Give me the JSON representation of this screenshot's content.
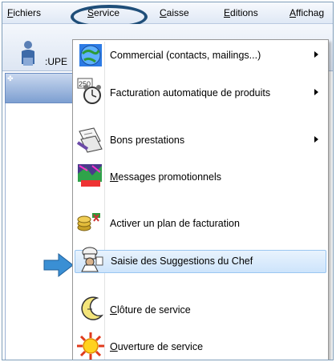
{
  "menubar": {
    "items": [
      {
        "label": "Fichiers",
        "ul": "F",
        "rest": "ichiers"
      },
      {
        "label": "Service",
        "ul": "S",
        "rest": "ervice"
      },
      {
        "label": "Caisse",
        "ul": "C",
        "rest": "aisse"
      },
      {
        "label": "Editions",
        "ul": "E",
        "rest": "ditions"
      },
      {
        "label": "Affichage",
        "ul": "A",
        "rest": "ffichag"
      }
    ]
  },
  "toolbar": {
    "user_label": ":UPE"
  },
  "service_menu": {
    "items": [
      {
        "ul": "",
        "rest": "Commercial (contacts, mailings...)",
        "icon": "globe-icon",
        "submenu": true
      },
      {
        "ul": "",
        "rest": "Facturation automatique de produits",
        "icon": "alarm-clock-icon",
        "submenu": true
      },
      {
        "ul": "",
        "rest": "Bons prestations",
        "icon": "voucher-icon",
        "submenu": true
      },
      {
        "ul": "M",
        "rest": "essages promotionnels",
        "icon": "promo-icon",
        "submenu": false
      },
      {
        "ul": "",
        "rest": "Activer un plan de facturation",
        "icon": "coins-icon",
        "submenu": false
      },
      {
        "ul": "",
        "rest": "Saisie des Suggestions du Chef",
        "icon": "chef-icon",
        "submenu": false,
        "highlighted": true
      },
      {
        "ul": "C",
        "rest": "lôture de service",
        "icon": "moon-icon",
        "submenu": false
      },
      {
        "ul": "O",
        "rest": "uverture de service",
        "icon": "sun-icon",
        "submenu": false
      }
    ]
  },
  "colors": {
    "accent": "#1f4e79",
    "highlight_border": "#9ac6f1",
    "pointer": "#3a8fd4"
  }
}
